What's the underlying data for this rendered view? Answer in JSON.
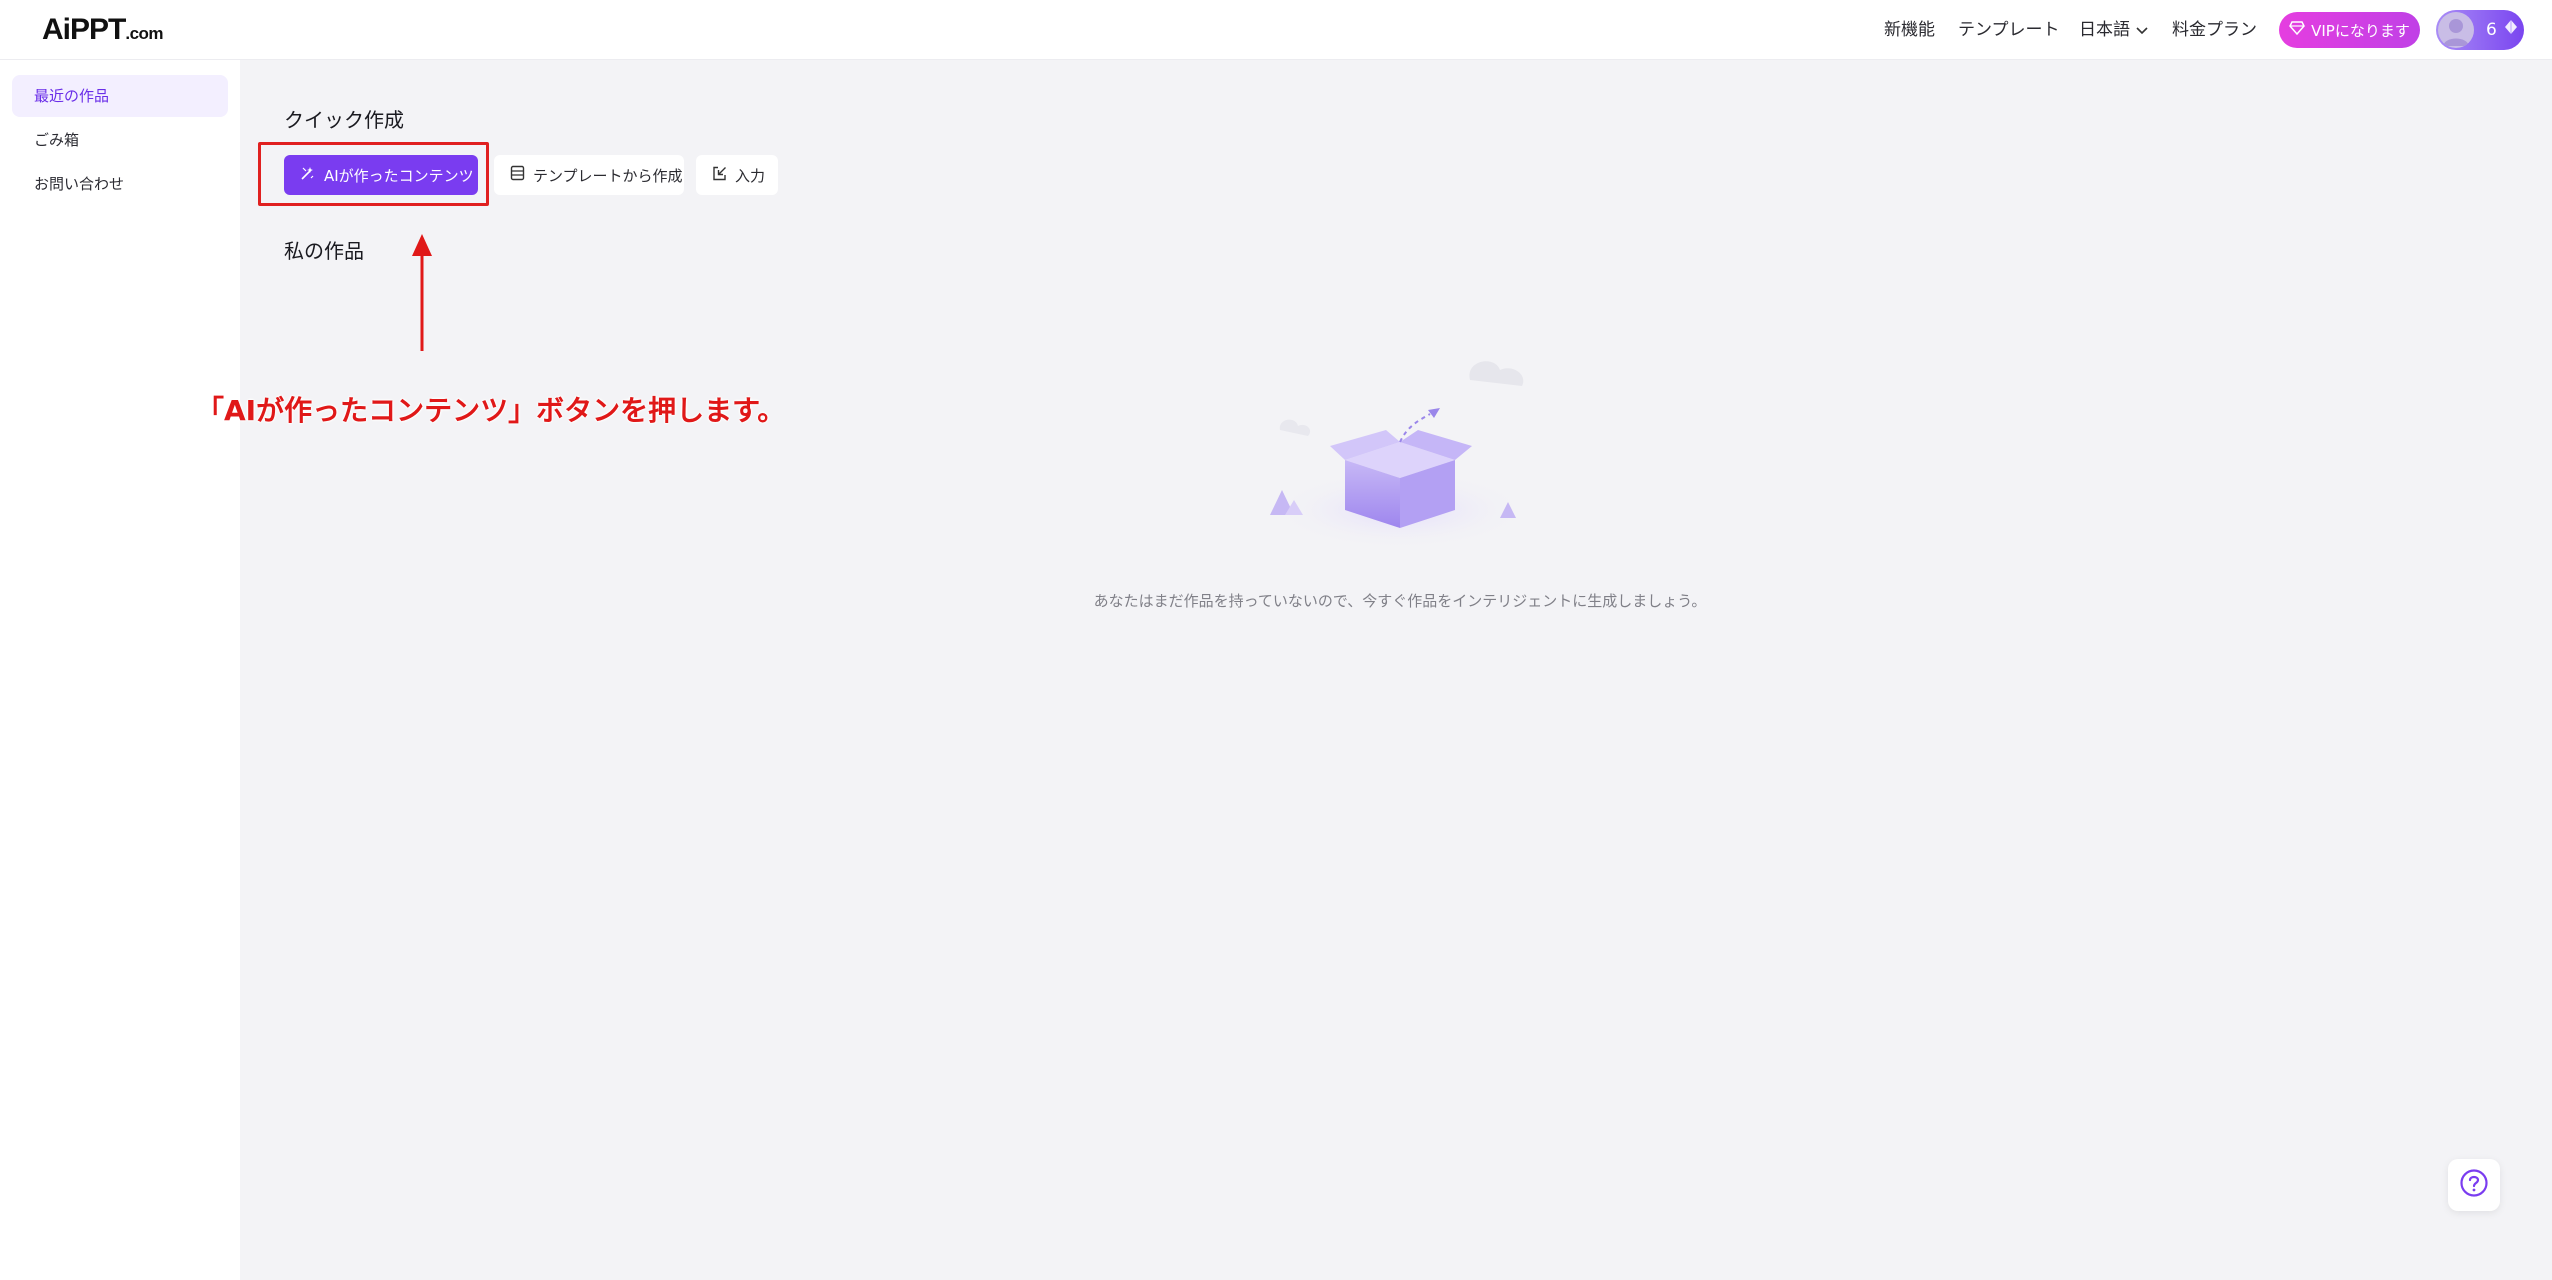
{
  "header": {
    "logo_main": "AiPPT",
    "logo_domain": ".com",
    "nav": {
      "new_features": "新機能",
      "templates": "テンプレート",
      "language": "日本語",
      "pricing": "料金プラン"
    },
    "vip_button": "VIPになります",
    "credits": "6"
  },
  "sidebar": {
    "items": [
      {
        "label": "最近の作品",
        "active": true
      },
      {
        "label": "ごみ箱",
        "active": false
      },
      {
        "label": "お問い合わせ",
        "active": false
      }
    ]
  },
  "main": {
    "quick_create_title": "クイック作成",
    "quick_buttons": {
      "ai_content": "AIが作ったコンテンツ",
      "from_template": "テンプレートから作成",
      "import": "入力"
    },
    "my_works_title": "私の作品",
    "empty_message": "あなたはまだ作品を持っていないので、今すぐ作品をインテリジェントに生成しましょう。"
  },
  "annotation": {
    "text": "「AIが作ったコンテンツ」ボタンを押します。"
  },
  "colors": {
    "accent": "#7a3cf0",
    "vip_gradient_start": "#e53ee0",
    "annotation_red": "#e01818"
  },
  "icons": {
    "ai_button": "magic-wand-icon",
    "template_button": "template-icon",
    "import_button": "import-icon",
    "vip": "diamond-icon",
    "credits": "gem-icon",
    "help": "help-circle-icon"
  }
}
